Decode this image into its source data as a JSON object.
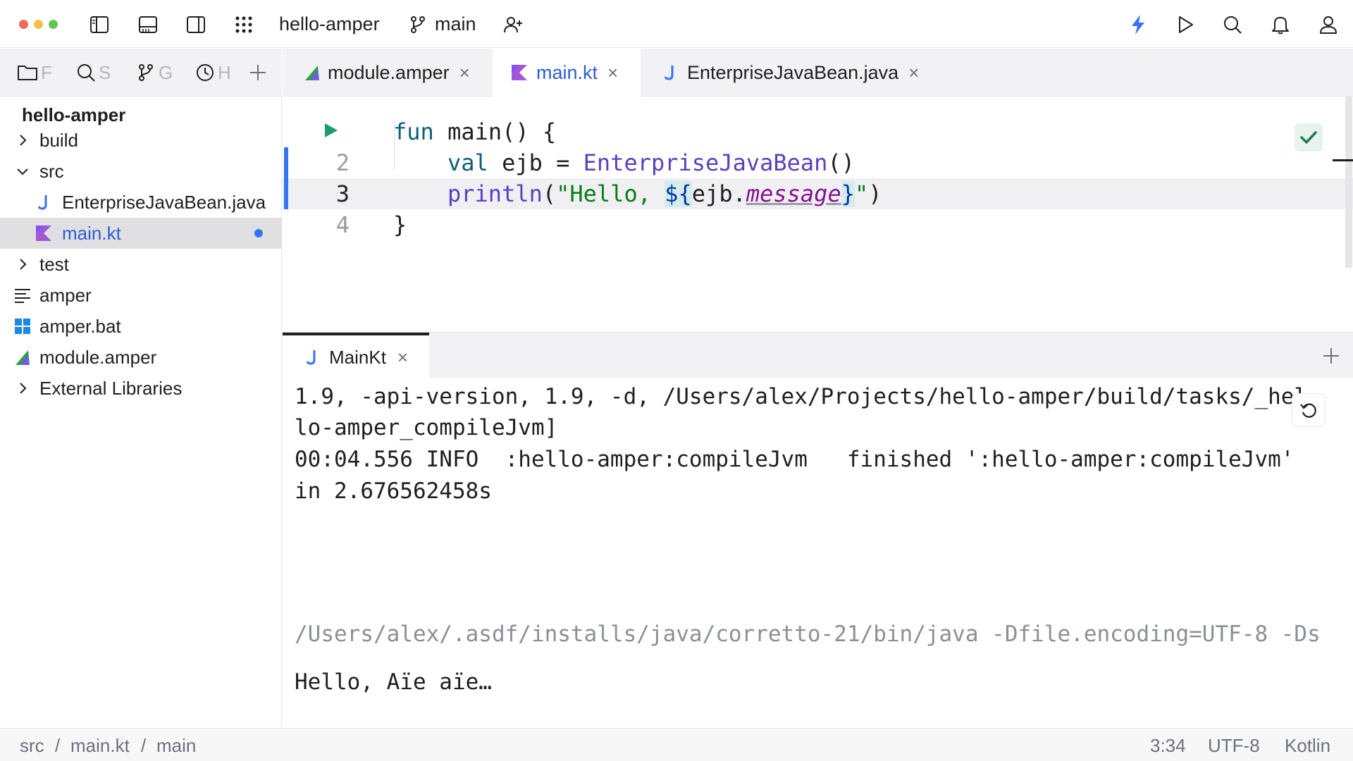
{
  "titlebar": {
    "project": "hello-amper",
    "branch": "main",
    "traffic_colors": [
      "#ed6a5e",
      "#f5bf4f",
      "#61c554"
    ],
    "icons": [
      "left-panel-icon",
      "bottom-panel-icon",
      "right-panel-icon",
      "apps-grid-icon",
      "branch-icon",
      "add-user-icon",
      "lightning-icon",
      "run-icon",
      "search-icon",
      "bell-icon",
      "profile-icon"
    ],
    "accent": "#3574f0"
  },
  "left_tabs": [
    {
      "icon": "folder-icon",
      "label": "F"
    },
    {
      "icon": "search-icon",
      "label": "S"
    },
    {
      "icon": "branch-icon",
      "label": "G"
    },
    {
      "icon": "clock-icon",
      "label": "H"
    }
  ],
  "project_tree": {
    "root": "hello-amper",
    "items": [
      {
        "label": "build",
        "expanded": false
      },
      {
        "label": "src",
        "expanded": true
      },
      {
        "label": "EnterpriseJavaBean.java",
        "icon": "java-icon"
      },
      {
        "label": "main.kt",
        "icon": "kotlin-icon",
        "selected": true,
        "modified": true
      },
      {
        "label": "test",
        "expanded": false
      },
      {
        "label": "amper",
        "icon": "text-file-icon"
      },
      {
        "label": "amper.bat",
        "icon": "windows-icon"
      },
      {
        "label": "module.amper",
        "icon": "amper-icon"
      },
      {
        "label": "External Libraries",
        "expanded": false
      }
    ]
  },
  "editor_tabs": [
    {
      "label": "module.amper",
      "icon": "amper-icon",
      "close": "×"
    },
    {
      "label": "main.kt",
      "icon": "kotlin-icon",
      "close": "×",
      "active": true
    },
    {
      "label": "EnterpriseJavaBean.java",
      "icon": "java-icon",
      "close": "×"
    }
  ],
  "editor": {
    "line_numbers": [
      "2",
      "3",
      "4"
    ],
    "lines": {
      "l1_kw": "fun",
      "l1_rest": " main() {",
      "l2_kw": "val",
      "l2_mid": " ejb = ",
      "l2_cls": "EnterpriseJavaBean",
      "l2_end": "()",
      "l3_fn": "println",
      "l3_open": "(",
      "l3_str": "\"Hello, ",
      "l3_t_open": "${",
      "l3_obj": "ejb.",
      "l3_prop": "message",
      "l3_t_close": "}",
      "l3_end_str": "\"",
      "l3_close": ")",
      "l4": "}"
    }
  },
  "run_panel": {
    "tab_label": "MainKt",
    "tab_close": "×",
    "console_lines": [
      "1.9, -api-version, 1.9, -d, /Users/alex/Projects/hello-amper/build/tasks/_hel",
      "lo-amper_compileJvm]",
      "00:04.556 INFO  :hello-amper:compileJvm   finished ':hello-amper:compileJvm'",
      "in 2.676562458s",
      "/Users/alex/.asdf/installs/java/corretto-21/bin/java -Dfile.encoding=UTF-8 -Ds",
      "Hello, Aïe aïe…"
    ]
  },
  "statusbar": {
    "breadcrumb": [
      "src",
      "main.kt",
      "main"
    ],
    "separator": "/",
    "position": "3:34",
    "encoding": "UTF-8",
    "language": "Kotlin"
  }
}
